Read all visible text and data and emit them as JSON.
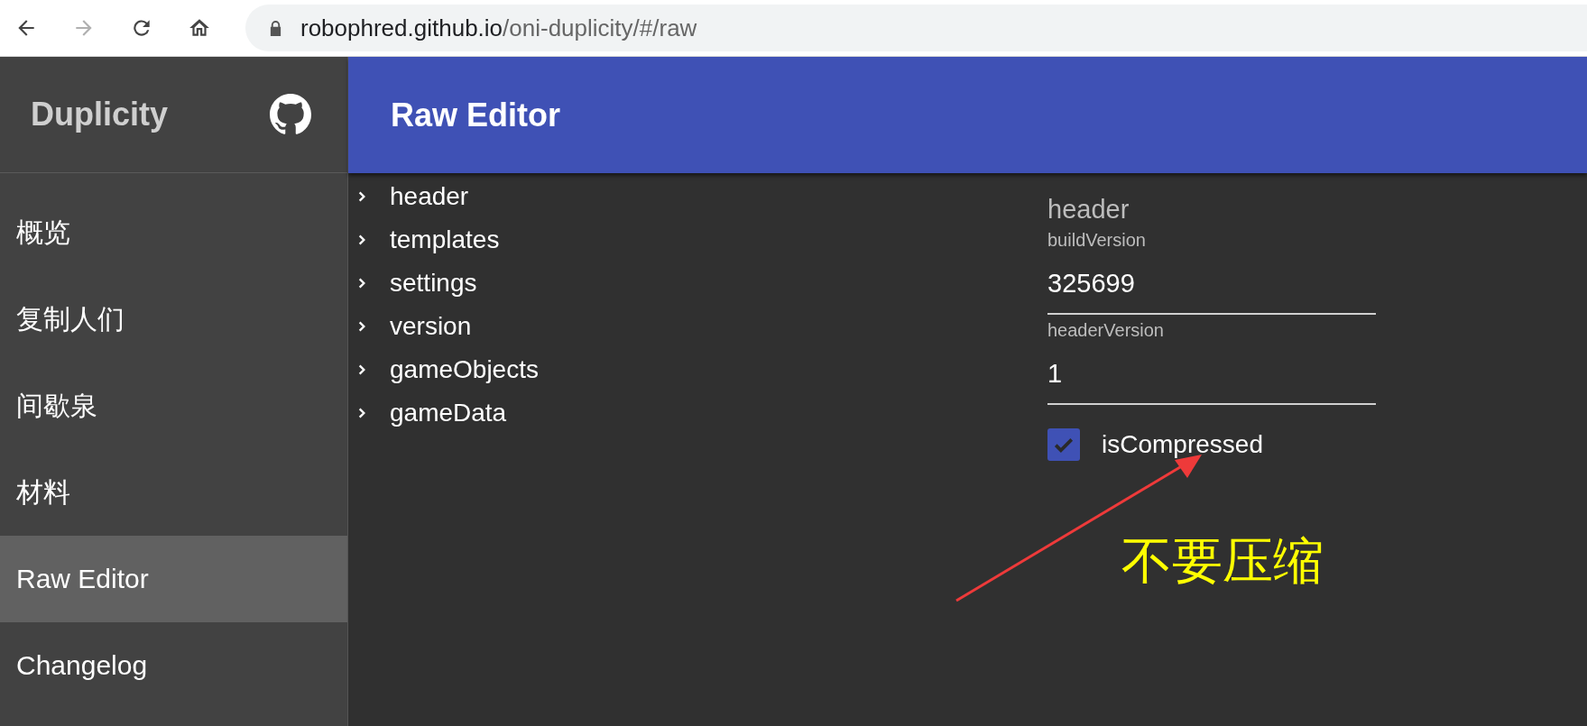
{
  "browser": {
    "url_host": "robophred.github.io",
    "url_path": "/oni-duplicity/#/raw",
    "back_disabled": false,
    "forward_disabled": true
  },
  "sidebar": {
    "title": "Duplicity",
    "items": [
      {
        "label": "概览",
        "selected": false
      },
      {
        "label": "复制人们",
        "selected": false
      },
      {
        "label": "间歇泉",
        "selected": false
      },
      {
        "label": "材料",
        "selected": false
      },
      {
        "label": "Raw Editor",
        "selected": true
      },
      {
        "label": "Changelog",
        "selected": false
      }
    ]
  },
  "app_bar": {
    "title": "Raw Editor"
  },
  "tree": [
    {
      "label": "header",
      "expanded": false
    },
    {
      "label": "templates",
      "expanded": false
    },
    {
      "label": "settings",
      "expanded": false
    },
    {
      "label": "version",
      "expanded": false
    },
    {
      "label": "gameObjects",
      "expanded": false
    },
    {
      "label": "gameData",
      "expanded": false
    }
  ],
  "detail": {
    "title": "header",
    "fields": [
      {
        "kind": "text",
        "label": "buildVersion",
        "value": "325699"
      },
      {
        "kind": "text",
        "label": "headerVersion",
        "value": "1"
      },
      {
        "kind": "checkbox",
        "label": "isCompressed",
        "checked": true
      }
    ]
  },
  "annotation": {
    "text": "不要压缩"
  }
}
